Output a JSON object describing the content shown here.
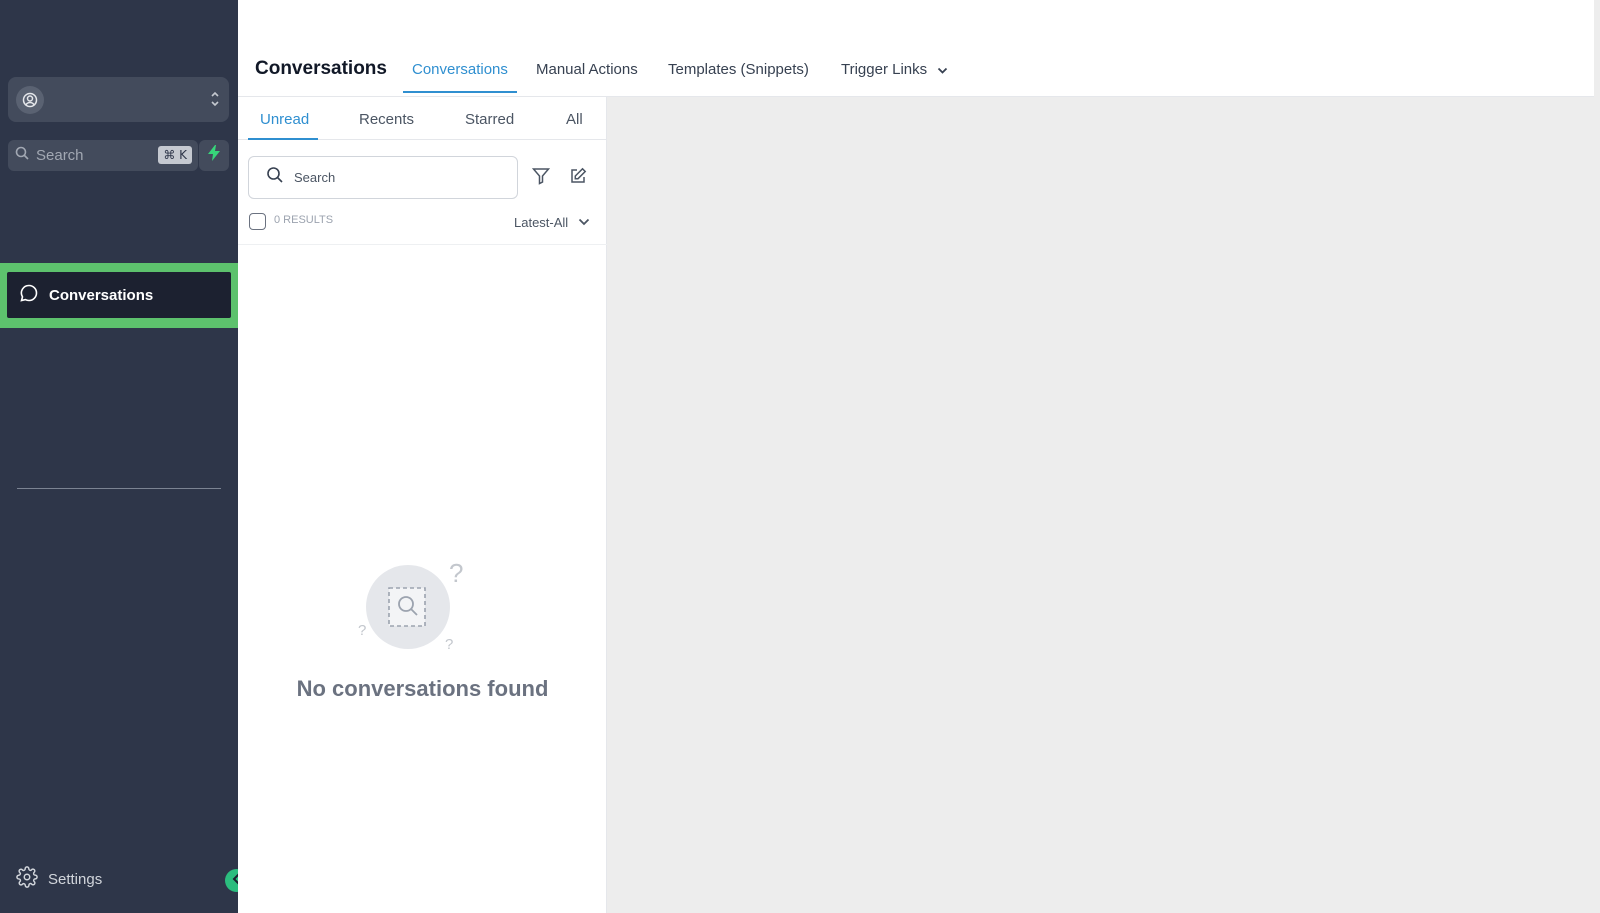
{
  "sidebar": {
    "search_label": "Search",
    "search_shortcut": "⌘ K",
    "nav_active_label": "Conversations",
    "settings_label": "Settings"
  },
  "header": {
    "title": "Conversations",
    "tabs": [
      {
        "label": "Conversations",
        "active": true
      },
      {
        "label": "Manual Actions"
      },
      {
        "label": "Templates (Snippets)"
      },
      {
        "label": "Trigger Links"
      }
    ]
  },
  "list": {
    "sub_tabs": [
      {
        "label": "Unread",
        "active": true
      },
      {
        "label": "Recents"
      },
      {
        "label": "Starred"
      },
      {
        "label": "All"
      }
    ],
    "search_label": "Search",
    "results_count": "0 RESULTS",
    "sort_value": "Latest-All",
    "empty_message": "No conversations found"
  },
  "colors": {
    "sidebar_bg": "#2e3649",
    "accent_blue": "#2f8fd0",
    "highlight_green": "#5dc26d",
    "toggle_green": "#2bbd7e"
  }
}
